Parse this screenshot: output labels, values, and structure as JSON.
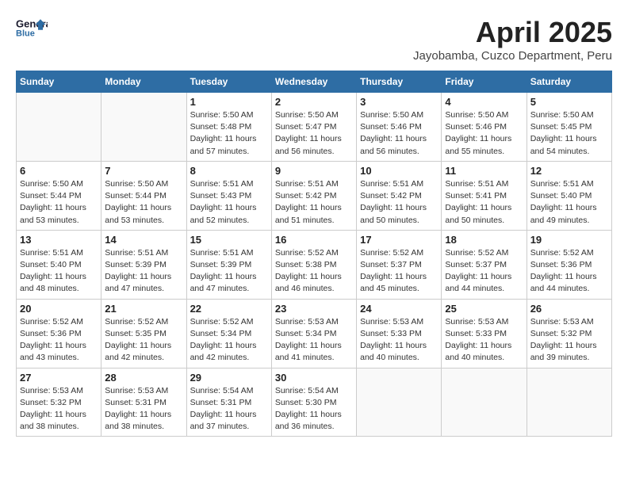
{
  "header": {
    "logo_general": "General",
    "logo_blue": "Blue",
    "month_title": "April 2025",
    "subtitle": "Jayobamba, Cuzco Department, Peru"
  },
  "weekdays": [
    "Sunday",
    "Monday",
    "Tuesday",
    "Wednesday",
    "Thursday",
    "Friday",
    "Saturday"
  ],
  "weeks": [
    [
      {
        "day": "",
        "sunrise": "",
        "sunset": "",
        "daylight": ""
      },
      {
        "day": "",
        "sunrise": "",
        "sunset": "",
        "daylight": ""
      },
      {
        "day": "1",
        "sunrise": "Sunrise: 5:50 AM",
        "sunset": "Sunset: 5:48 PM",
        "daylight": "Daylight: 11 hours and 57 minutes."
      },
      {
        "day": "2",
        "sunrise": "Sunrise: 5:50 AM",
        "sunset": "Sunset: 5:47 PM",
        "daylight": "Daylight: 11 hours and 56 minutes."
      },
      {
        "day": "3",
        "sunrise": "Sunrise: 5:50 AM",
        "sunset": "Sunset: 5:46 PM",
        "daylight": "Daylight: 11 hours and 56 minutes."
      },
      {
        "day": "4",
        "sunrise": "Sunrise: 5:50 AM",
        "sunset": "Sunset: 5:46 PM",
        "daylight": "Daylight: 11 hours and 55 minutes."
      },
      {
        "day": "5",
        "sunrise": "Sunrise: 5:50 AM",
        "sunset": "Sunset: 5:45 PM",
        "daylight": "Daylight: 11 hours and 54 minutes."
      }
    ],
    [
      {
        "day": "6",
        "sunrise": "Sunrise: 5:50 AM",
        "sunset": "Sunset: 5:44 PM",
        "daylight": "Daylight: 11 hours and 53 minutes."
      },
      {
        "day": "7",
        "sunrise": "Sunrise: 5:50 AM",
        "sunset": "Sunset: 5:44 PM",
        "daylight": "Daylight: 11 hours and 53 minutes."
      },
      {
        "day": "8",
        "sunrise": "Sunrise: 5:51 AM",
        "sunset": "Sunset: 5:43 PM",
        "daylight": "Daylight: 11 hours and 52 minutes."
      },
      {
        "day": "9",
        "sunrise": "Sunrise: 5:51 AM",
        "sunset": "Sunset: 5:42 PM",
        "daylight": "Daylight: 11 hours and 51 minutes."
      },
      {
        "day": "10",
        "sunrise": "Sunrise: 5:51 AM",
        "sunset": "Sunset: 5:42 PM",
        "daylight": "Daylight: 11 hours and 50 minutes."
      },
      {
        "day": "11",
        "sunrise": "Sunrise: 5:51 AM",
        "sunset": "Sunset: 5:41 PM",
        "daylight": "Daylight: 11 hours and 50 minutes."
      },
      {
        "day": "12",
        "sunrise": "Sunrise: 5:51 AM",
        "sunset": "Sunset: 5:40 PM",
        "daylight": "Daylight: 11 hours and 49 minutes."
      }
    ],
    [
      {
        "day": "13",
        "sunrise": "Sunrise: 5:51 AM",
        "sunset": "Sunset: 5:40 PM",
        "daylight": "Daylight: 11 hours and 48 minutes."
      },
      {
        "day": "14",
        "sunrise": "Sunrise: 5:51 AM",
        "sunset": "Sunset: 5:39 PM",
        "daylight": "Daylight: 11 hours and 47 minutes."
      },
      {
        "day": "15",
        "sunrise": "Sunrise: 5:51 AM",
        "sunset": "Sunset: 5:39 PM",
        "daylight": "Daylight: 11 hours and 47 minutes."
      },
      {
        "day": "16",
        "sunrise": "Sunrise: 5:52 AM",
        "sunset": "Sunset: 5:38 PM",
        "daylight": "Daylight: 11 hours and 46 minutes."
      },
      {
        "day": "17",
        "sunrise": "Sunrise: 5:52 AM",
        "sunset": "Sunset: 5:37 PM",
        "daylight": "Daylight: 11 hours and 45 minutes."
      },
      {
        "day": "18",
        "sunrise": "Sunrise: 5:52 AM",
        "sunset": "Sunset: 5:37 PM",
        "daylight": "Daylight: 11 hours and 44 minutes."
      },
      {
        "day": "19",
        "sunrise": "Sunrise: 5:52 AM",
        "sunset": "Sunset: 5:36 PM",
        "daylight": "Daylight: 11 hours and 44 minutes."
      }
    ],
    [
      {
        "day": "20",
        "sunrise": "Sunrise: 5:52 AM",
        "sunset": "Sunset: 5:36 PM",
        "daylight": "Daylight: 11 hours and 43 minutes."
      },
      {
        "day": "21",
        "sunrise": "Sunrise: 5:52 AM",
        "sunset": "Sunset: 5:35 PM",
        "daylight": "Daylight: 11 hours and 42 minutes."
      },
      {
        "day": "22",
        "sunrise": "Sunrise: 5:52 AM",
        "sunset": "Sunset: 5:34 PM",
        "daylight": "Daylight: 11 hours and 42 minutes."
      },
      {
        "day": "23",
        "sunrise": "Sunrise: 5:53 AM",
        "sunset": "Sunset: 5:34 PM",
        "daylight": "Daylight: 11 hours and 41 minutes."
      },
      {
        "day": "24",
        "sunrise": "Sunrise: 5:53 AM",
        "sunset": "Sunset: 5:33 PM",
        "daylight": "Daylight: 11 hours and 40 minutes."
      },
      {
        "day": "25",
        "sunrise": "Sunrise: 5:53 AM",
        "sunset": "Sunset: 5:33 PM",
        "daylight": "Daylight: 11 hours and 40 minutes."
      },
      {
        "day": "26",
        "sunrise": "Sunrise: 5:53 AM",
        "sunset": "Sunset: 5:32 PM",
        "daylight": "Daylight: 11 hours and 39 minutes."
      }
    ],
    [
      {
        "day": "27",
        "sunrise": "Sunrise: 5:53 AM",
        "sunset": "Sunset: 5:32 PM",
        "daylight": "Daylight: 11 hours and 38 minutes."
      },
      {
        "day": "28",
        "sunrise": "Sunrise: 5:53 AM",
        "sunset": "Sunset: 5:31 PM",
        "daylight": "Daylight: 11 hours and 38 minutes."
      },
      {
        "day": "29",
        "sunrise": "Sunrise: 5:54 AM",
        "sunset": "Sunset: 5:31 PM",
        "daylight": "Daylight: 11 hours and 37 minutes."
      },
      {
        "day": "30",
        "sunrise": "Sunrise: 5:54 AM",
        "sunset": "Sunset: 5:30 PM",
        "daylight": "Daylight: 11 hours and 36 minutes."
      },
      {
        "day": "",
        "sunrise": "",
        "sunset": "",
        "daylight": ""
      },
      {
        "day": "",
        "sunrise": "",
        "sunset": "",
        "daylight": ""
      },
      {
        "day": "",
        "sunrise": "",
        "sunset": "",
        "daylight": ""
      }
    ]
  ]
}
